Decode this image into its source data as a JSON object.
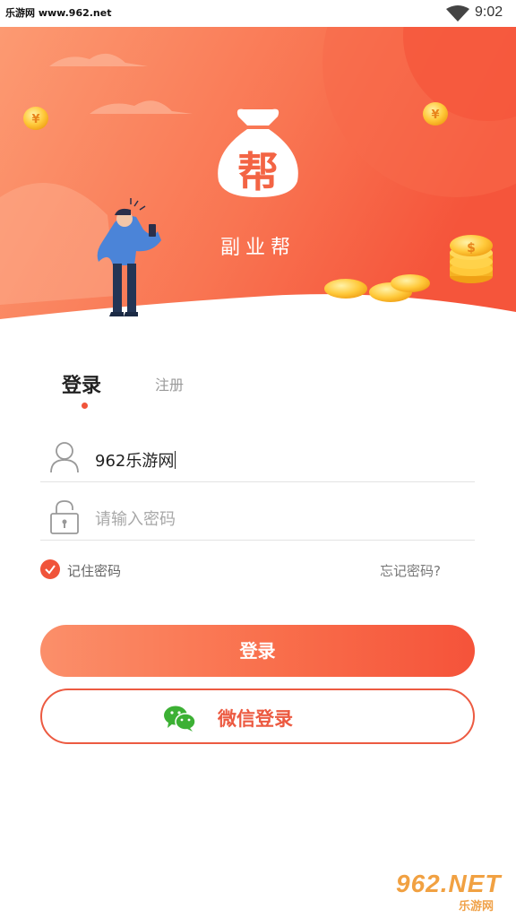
{
  "status_bar": {
    "site_label": "乐游网 www.962.net",
    "time": "9:02"
  },
  "brand": {
    "logo_char": "帮",
    "name": "副业帮"
  },
  "tabs": {
    "login": "登录",
    "register": "注册"
  },
  "form": {
    "username_value": "962乐游网",
    "password_placeholder": "请输入密码",
    "remember_label": "记住密码",
    "remember_checked": true,
    "forgot_label": "忘记密码?"
  },
  "buttons": {
    "login": "登录",
    "wechat_login": "微信登录"
  },
  "watermark": {
    "big": "962.NET",
    "small": "乐游网"
  },
  "colors": {
    "accent": "#f0543a",
    "hero_start": "#fb8f6a",
    "hero_end": "#f5533a"
  },
  "icons": [
    "wifi-icon",
    "money-bag-logo-icon",
    "user-icon",
    "lock-icon",
    "check-icon",
    "wechat-icon"
  ]
}
